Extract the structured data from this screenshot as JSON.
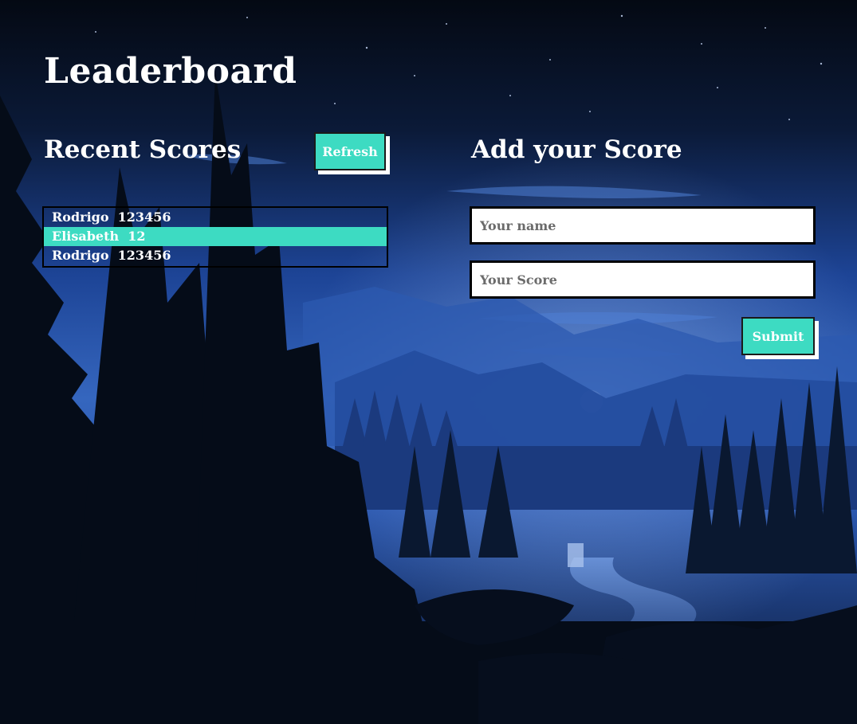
{
  "header": {
    "title": "Leaderboard"
  },
  "recent": {
    "title": "Recent Scores",
    "refresh_label": "Refresh",
    "scores": [
      {
        "text": "Rodrigo  123456"
      },
      {
        "text": "Elisabeth  12"
      },
      {
        "text": "Rodrigo  123456"
      }
    ]
  },
  "add": {
    "title": "Add your Score",
    "name_placeholder": "Your name",
    "name_value": "",
    "score_placeholder": "Your Score",
    "score_value": "",
    "submit_label": "Submit"
  },
  "colors": {
    "accent": "#3ddbc2",
    "text": "#ffffff",
    "sky_top": "#050b17",
    "sky_mid": "#1a3f8c",
    "mist": "#3f6fc8",
    "forest_dark": "#060d19"
  },
  "background": {
    "description_icon": "night-forest-landscape"
  }
}
